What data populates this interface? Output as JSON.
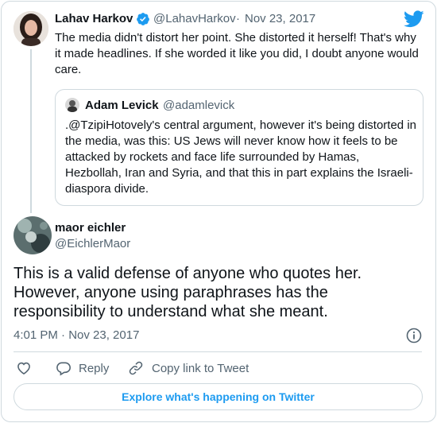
{
  "parent_tweet": {
    "author_name": "Lahav Harkov",
    "author_handle": "@LahavHarkov",
    "separator": "·",
    "date": "Nov 23, 2017",
    "text": "The media didn't distort her point. She distorted it herself! That's why it made headlines. If she worded it like you did, I doubt anyone would care."
  },
  "quoted_tweet": {
    "author_name": "Adam Levick",
    "author_handle": "@adamlevick",
    "text": ".@TzipiHotovely's central argument, however it's being distorted in the media, was this: US Jews will never know how it feels to be attacked by rockets and face life surrounded by Hamas, Hezbollah, Iran and Syria, and that this in part explains the Israeli-diaspora divide."
  },
  "main_tweet": {
    "author_name": "maor eichler",
    "author_handle": "@EichlerMaor",
    "text": "This is a valid defense of anyone who quotes her. However, anyone using paraphrases has the responsibility to understand what she meant.",
    "timestamp": "4:01 PM · Nov 23, 2017"
  },
  "actions": {
    "reply_label": "Reply",
    "copy_link_label": "Copy link to Tweet"
  },
  "explore_label": "Explore what's happening on Twitter",
  "icons": {
    "brand": "twitter-bird-icon",
    "verified": "verified-badge-icon",
    "info": "info-icon",
    "like": "heart-icon",
    "reply": "speech-bubble-icon",
    "link": "link-icon"
  },
  "colors": {
    "accent": "#1d9bf0",
    "text": "#0f1419",
    "muted": "#536471",
    "border": "#cfd9de"
  }
}
